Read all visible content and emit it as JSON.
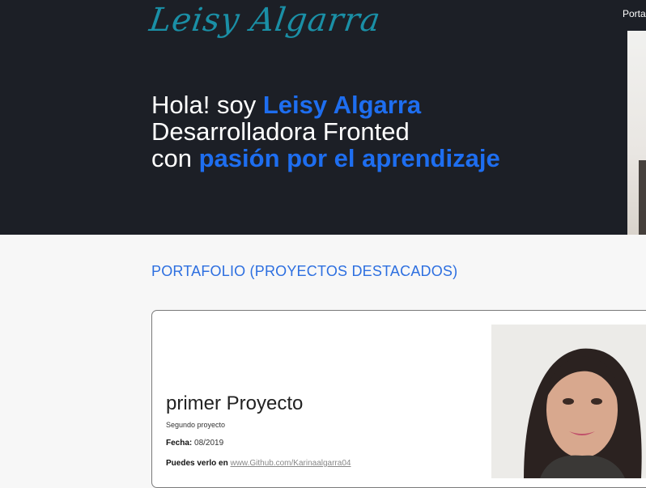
{
  "header": {
    "logo_text": "Leisy Algarra",
    "nav_link": "Porta"
  },
  "hero": {
    "line1_prefix": "Hola! soy ",
    "line1_name": "Leisy Algarra",
    "line2": "Desarrolladora Fronted",
    "line3_prefix": "con ",
    "line3_highlight": "pasión por el aprendizaje"
  },
  "portfolio": {
    "section_title": "PORTAFOLIO (PROYECTOS DESTACADOS)",
    "project": {
      "title": "primer Proyecto",
      "subtitle": "Segundo proyecto",
      "date_label": "Fecha:",
      "date_value": "08/2019",
      "link_label": "Puedes verlo en",
      "link_text": "www.Github.com/Karinaalgarra04"
    }
  },
  "colors": {
    "hero_bg": "#1c1f26",
    "accent": "#1e6ef0",
    "logo": "#1a8fa6"
  }
}
